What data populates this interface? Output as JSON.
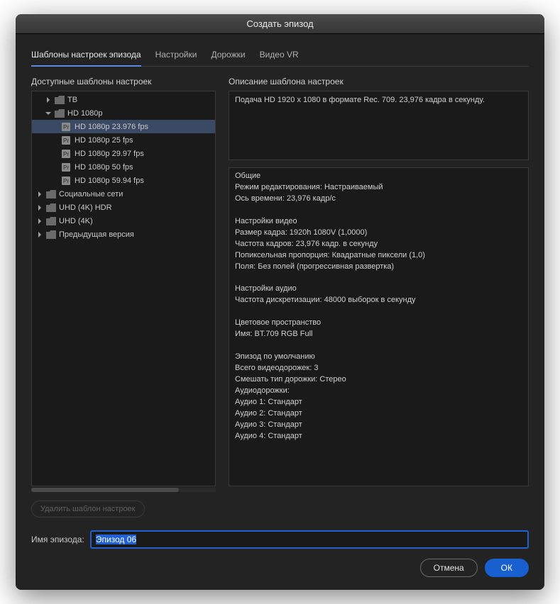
{
  "window": {
    "title": "Создать эпизод"
  },
  "tabs": [
    {
      "label": "Шаблоны настроек эпизода",
      "active": true
    },
    {
      "label": "Настройки"
    },
    {
      "label": "Дорожки"
    },
    {
      "label": "Видео VR"
    }
  ],
  "left": {
    "title": "Доступные шаблоны настроек",
    "tree": [
      {
        "kind": "folder",
        "label": "ТВ",
        "expanded": false,
        "level": 1
      },
      {
        "kind": "folder",
        "label": "HD 1080p",
        "expanded": true,
        "level": 1
      },
      {
        "kind": "preset",
        "label": "HD 1080p 23.976 fps",
        "level": 2,
        "selected": true
      },
      {
        "kind": "preset",
        "label": "HD 1080p 25 fps",
        "level": 2
      },
      {
        "kind": "preset",
        "label": "HD 1080p 29.97 fps",
        "level": 2
      },
      {
        "kind": "preset",
        "label": "HD 1080p 50 fps",
        "level": 2
      },
      {
        "kind": "preset",
        "label": "HD 1080p 59.94 fps",
        "level": 2
      },
      {
        "kind": "folder",
        "label": "Социальные сети",
        "expanded": false,
        "level": 0
      },
      {
        "kind": "folder",
        "label": "UHD (4K) HDR",
        "expanded": false,
        "level": 0
      },
      {
        "kind": "folder",
        "label": "UHD (4K)",
        "expanded": false,
        "level": 0
      },
      {
        "kind": "folder",
        "label": "Предыдущая версия",
        "expanded": false,
        "level": 0
      }
    ],
    "delete_label": "Удалить шаблон настроек"
  },
  "right": {
    "title": "Описание шаблона настроек",
    "summary": "Подача HD 1920 x 1080 в формате Rec. 709. 23,976 кадра в секунду.",
    "details": "Общие\n Режим редактирования: Настраиваемый\n Ось времени: 23,976 кадр/с\n\nНастройки видео\n Размер кадра: 1920h 1080V (1,0000)\n Частота кадров: 23,976  кадр. в секунду\n Попиксельная пропорция: Квадратные пиксели (1,0)\n Поля: Без полей (прогрессивная развертка)\n\nНастройки аудио\n Частота дискретизации: 48000 выборок в секунду\n\nЦветовое пространство\n Имя: BT.709 RGB Full\n\nЭпизод по умолчанию\n Всего видеодорожек: 3\n Смешать тип дорожки: Стерео\n Аудиодорожки:\n Аудио 1: Стандарт\n Аудио 2: Стандарт\n Аудио 3: Стандарт\n Аудио 4: Стандарт"
  },
  "sequence": {
    "name_label": "Имя эпизода:",
    "name_value": "Эпизод 06"
  },
  "buttons": {
    "cancel": "Отмена",
    "ok": "ОК"
  }
}
